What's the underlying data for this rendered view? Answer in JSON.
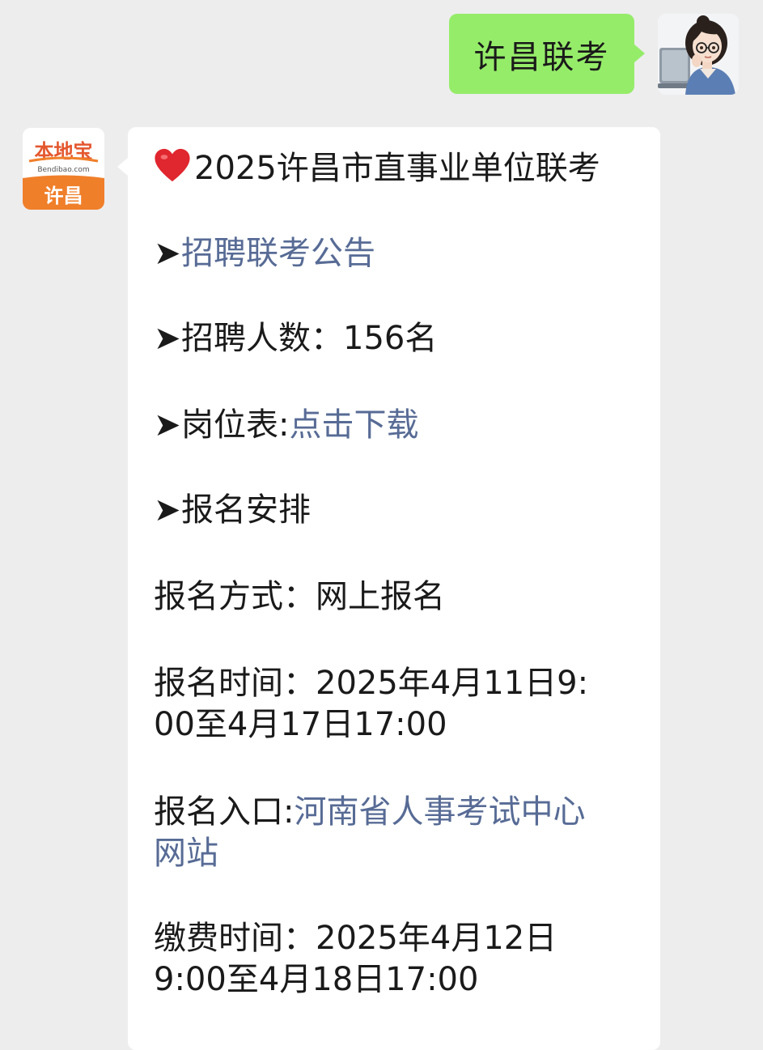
{
  "user_message": {
    "text": "许昌联考"
  },
  "bot_avatar": {
    "brand": "本地宝",
    "domain": "Bendibao.com",
    "city": "许昌"
  },
  "bot_message": {
    "heading": "2025许昌市直事业单位联考",
    "arrow_glyph": "➤",
    "notice_link": "招聘联考公告",
    "headcount_label": "招聘人数：",
    "headcount_value": "156名",
    "table_label": "岗位表:",
    "table_link": "点击下载",
    "registration_heading": "报名安排",
    "method_label": "报名方式：",
    "method_value": "网上报名",
    "reg_time_label": "报名时间：",
    "reg_time_line1": "2025年4月11日9:",
    "reg_time_line2": "00至4月17日17:00",
    "entry_label": "报名入口:",
    "entry_link_line1": "河南省人事考试中心",
    "entry_link_line2": "网站",
    "pay_time_label": "缴费时间：",
    "pay_time_line1": "2025年4月12日",
    "pay_time_line2": "9:00至4月18日17:00"
  },
  "colors": {
    "background": "#ededed",
    "outgoing_bubble": "#95ec69",
    "incoming_bubble": "#ffffff",
    "link": "#576b95",
    "brand_orange": "#f07f2a"
  }
}
